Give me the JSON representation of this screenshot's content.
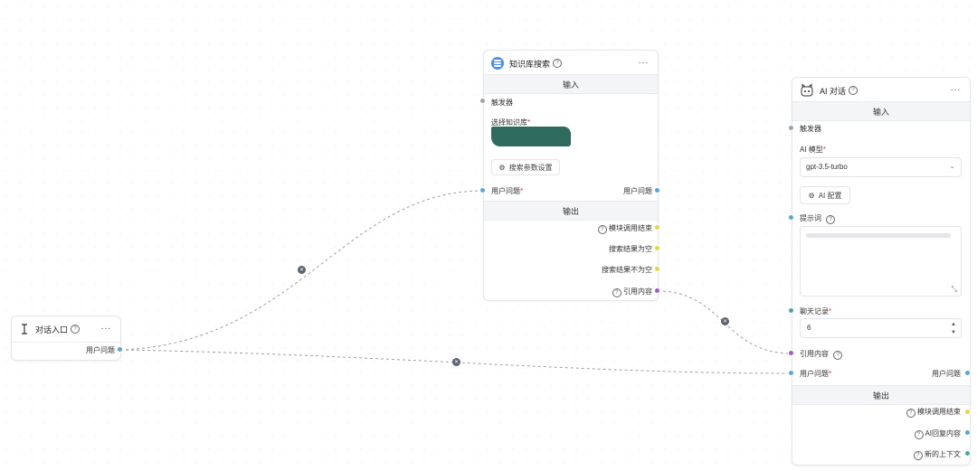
{
  "colors": {
    "handle_gray": "#a0a4ab",
    "handle_blue": "#5aa6d6",
    "handle_yellow": "#e2d94a",
    "handle_purple": "#a25ec2",
    "handle_teal": "#4aa7a0",
    "required": "#e53935",
    "edge": "#9aa0a8"
  },
  "icons": {
    "knowledge": "database-icon",
    "entry": "text-cursor-icon",
    "ai": "robot-icon",
    "help": "help-circle-icon",
    "more": "more-dots-icon",
    "gear": "gear-icon",
    "cut": "close-circle-icon"
  },
  "common": {
    "help": "?",
    "more": "···",
    "required": "*",
    "cut": "✕"
  },
  "entry_node": {
    "title": "对话入口",
    "output_user_question": "用户问题"
  },
  "kb_node": {
    "title": "知识库搜索",
    "input_section": "输入",
    "trigger": "触发器",
    "select_kb_label": "选择知识库",
    "search_params_button": "搜索参数设置",
    "input_user_question": "用户问题",
    "output_user_question": "用户问题",
    "output_section": "输出",
    "outputs": {
      "module_end": "模块调用结束",
      "result_empty": "搜索结果为空",
      "result_not_empty": "搜索结果不为空",
      "quote_content": "引用内容"
    }
  },
  "ai_node": {
    "title": "AI 对话",
    "input_section": "输入",
    "trigger": "触发器",
    "model_label": "AI 模型",
    "model_value": "gpt-3.5-turbo",
    "ai_config_button": "AI 配置",
    "prompt_label": "提示词",
    "history_label": "聊天记录",
    "history_value": "6",
    "quote_label": "引用内容",
    "input_user_question": "用户问题",
    "output_user_question": "用户问题",
    "output_section": "输出",
    "outputs": {
      "module_end": "模块调用结束",
      "ai_reply": "AI回复内容",
      "new_context": "新的上下文"
    }
  }
}
